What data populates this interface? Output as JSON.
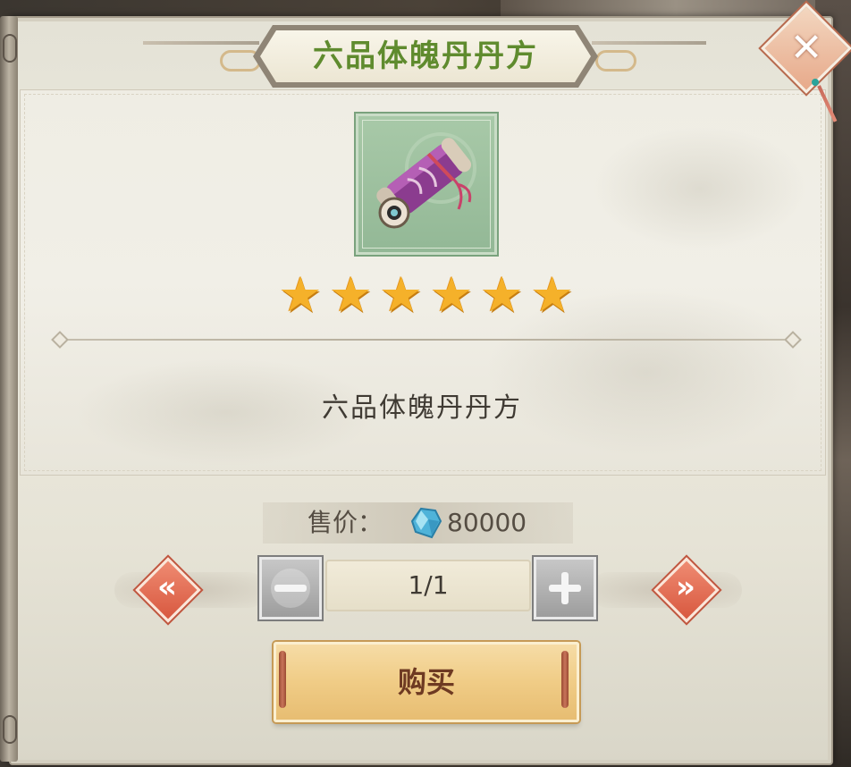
{
  "dialog": {
    "title": "六品体魄丹丹方",
    "close_icon": "close-icon"
  },
  "item": {
    "icon": "scroll-icon",
    "name": "六品体魄丹丹方",
    "rating": 6,
    "rating_max": 6,
    "star_glyph": "★"
  },
  "price": {
    "label": "售价：",
    "currency_icon": "spirit-stone-icon",
    "value": "80000"
  },
  "quantity": {
    "value": "1/1",
    "prev_icon": "chevron-left-icon",
    "next_icon": "chevron-right-icon",
    "decrease_icon": "minus-icon",
    "increase_icon": "plus-icon"
  },
  "buy_button": {
    "label": "购买"
  },
  "colors": {
    "title": "#5f8b2e",
    "star": "#f5b12a",
    "accent_red": "#d8583f",
    "button_gold": "#f0cc86"
  }
}
